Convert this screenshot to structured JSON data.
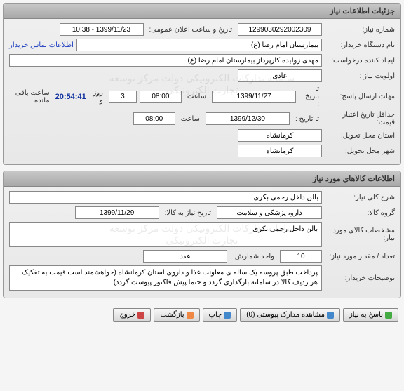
{
  "panel1": {
    "title": "جزئیات اطلاعات نیاز",
    "need_number_label": "شماره نیاز:",
    "need_number": "1299030292002309",
    "announce_label": "تاریخ و ساعت اعلان عمومی:",
    "announce_value": "1399/11/23 - 10:38",
    "buyer_device_label": "نام دستگاه خریدار:",
    "buyer_device": "بیمارستان امام رضا (ع)",
    "contact_link": "اطلاعات تماس خریدار",
    "requester_label": "ایجاد کننده درخواست:",
    "requester": "مهدی زولیده کارپرداز بیمارستان امام رضا (ع)",
    "priority_label": "اولویت نیاز :",
    "priority": "عادی",
    "deadline_label": "مهلت ارسال پاسخ:",
    "to_date_label": "تا تاریخ :",
    "deadline_date": "1399/11/27",
    "time_label": "ساعت",
    "deadline_time": "08:00",
    "days_label": "روز و",
    "days": "3",
    "countdown": "20:54:41",
    "remaining_label": "ساعت باقی مانده",
    "min_validity_label": "حداقل تاریخ اعتبار قیمت:",
    "validity_date": "1399/12/30",
    "validity_time": "08:00",
    "delivery_province_label": "استان محل تحویل:",
    "delivery_province": "کرمانشاه",
    "delivery_city_label": "شهر محل تحویل:",
    "delivery_city": "کرمانشاه"
  },
  "panel2": {
    "title": "اطلاعات کالاهای مورد نیاز",
    "general_desc_label": "شرح کلی نیاز:",
    "general_desc": "بالن داخل رحمی بکری",
    "goods_group_label": "گروه کالا:",
    "goods_group": "دارو، پزشکی و سلامت",
    "need_by_date_label": "تاریخ نیاز به کالا:",
    "need_by_date": "1399/11/29",
    "goods_spec_label": "مشخصات کالای مورد نیاز:",
    "goods_spec": "بالن داخل رحمی بکری",
    "qty_label": "تعداد / مقدار مورد نیاز:",
    "qty": "10",
    "unit_label": "واحد شمارش:",
    "unit": "عدد",
    "buyer_notes_label": "توضیحات خریدار:",
    "buyer_notes": "پرداخت طبق پروسه یک ساله ی معاونت غذا و داروی استان کرمانشاه (خواهشمند است قیمت به تفکیک هر ردیف کالا در سامانه بارگذاری گردد و حتما پیش فاکتور پیوست گردد)"
  },
  "buttons": {
    "reply": "پاسخ به نیاز",
    "attachments": "مشاهده مدارک پیوستی",
    "attachments_count": "(0)",
    "print": "چاپ",
    "back": "بازگشت",
    "exit": "خروج"
  },
  "watermark": "سامانه تدارکات الکترونیکی دولت\nمرکز توسعه تجارت الکترونیکی"
}
